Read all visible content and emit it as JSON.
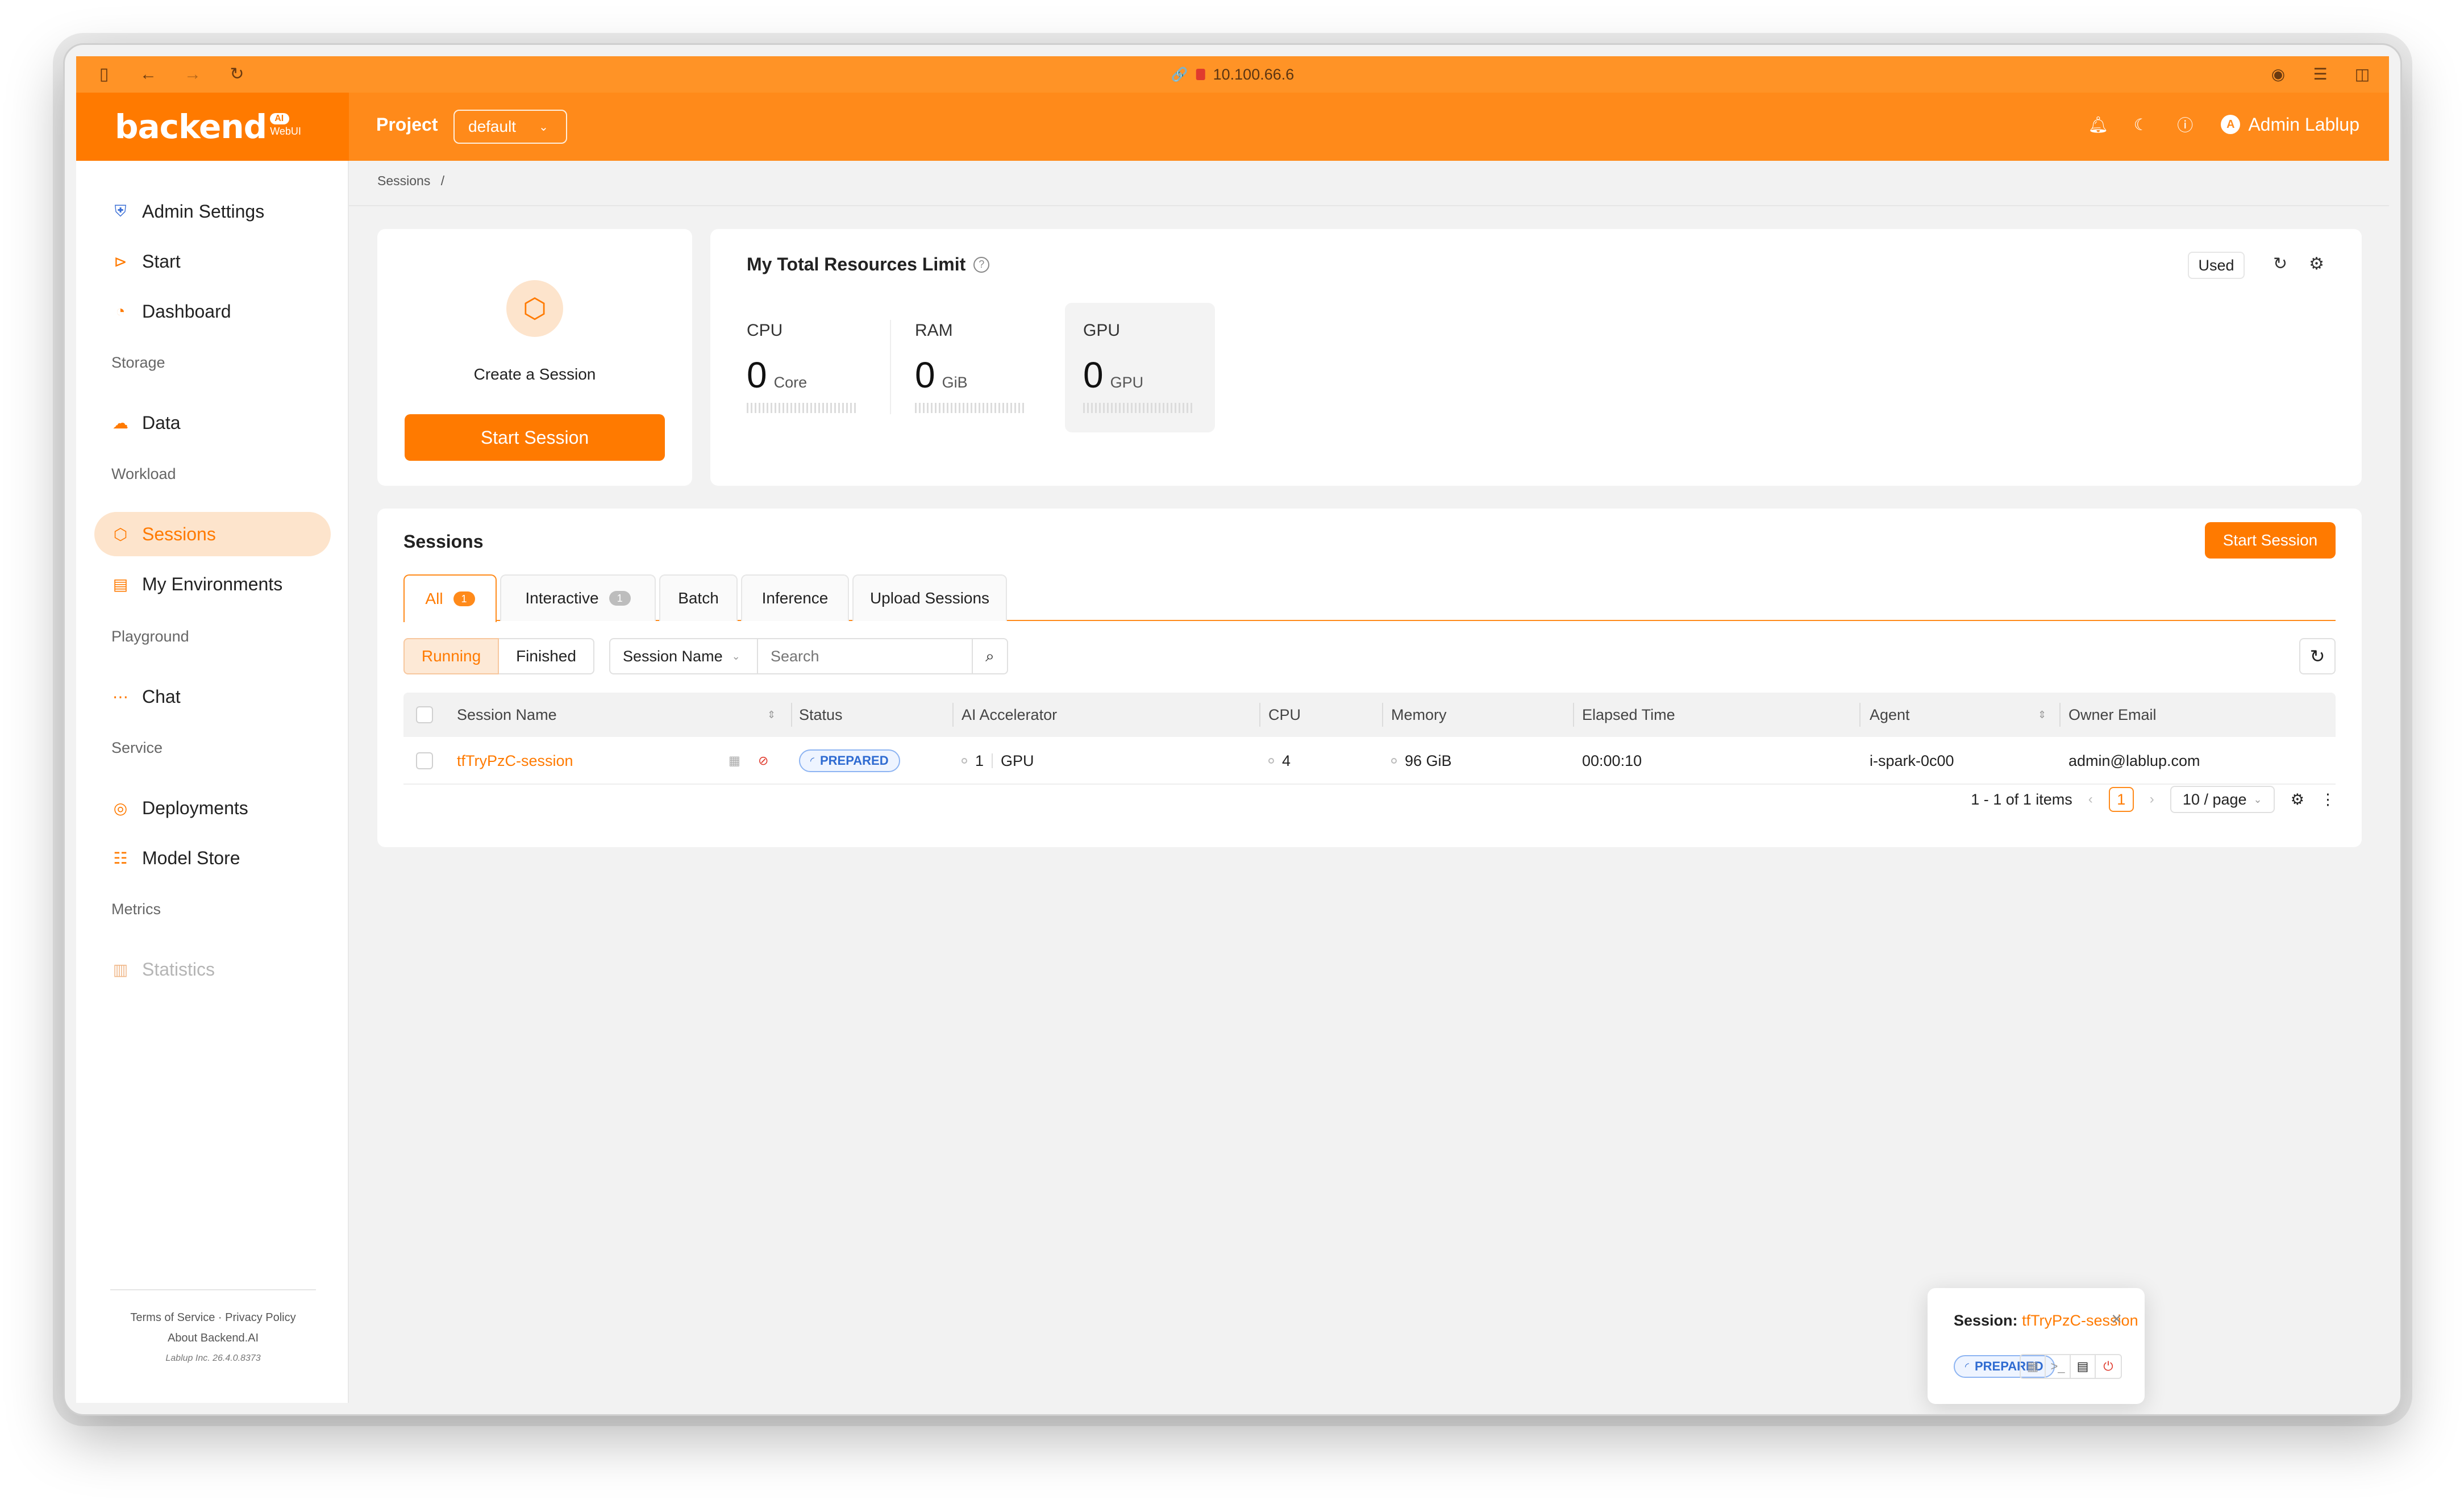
{
  "browser": {
    "url": "10.100.66.6"
  },
  "header": {
    "logo": "backend",
    "logo_badge": "AI",
    "logo_sub": "WebUI",
    "project_label": "Project",
    "project_value": "default",
    "user_name": "Admin Lablup",
    "user_initial": "A"
  },
  "sidebar": {
    "items": [
      {
        "label": "Admin Settings",
        "icon": "shield-icon"
      },
      {
        "label": "Start",
        "icon": "play-circle-icon"
      },
      {
        "label": "Dashboard",
        "icon": "dashboard-icon"
      }
    ],
    "groups": {
      "storage": "Storage",
      "workload": "Workload",
      "playground": "Playground",
      "service": "Service",
      "metrics": "Metrics"
    },
    "storage_items": [
      {
        "label": "Data",
        "icon": "cloud-upload-icon"
      }
    ],
    "workload_items": [
      {
        "label": "Sessions",
        "icon": "cube-icon",
        "active": true
      },
      {
        "label": "My Environments",
        "icon": "file-image-icon"
      }
    ],
    "playground_items": [
      {
        "label": "Chat",
        "icon": "chat-icon"
      }
    ],
    "service_items": [
      {
        "label": "Deployments",
        "icon": "rocket-icon"
      },
      {
        "label": "Model Store",
        "icon": "database-icon"
      }
    ],
    "metrics_items": [
      {
        "label": "Statistics",
        "icon": "bar-chart-icon",
        "disabled": true
      }
    ],
    "footer": {
      "terms": "Terms of Service",
      "privacy": "Privacy Policy",
      "about": "About Backend.AI",
      "version": "Lablup Inc. 26.4.0.8373"
    }
  },
  "breadcrumb": {
    "item": "Sessions",
    "sep": "/"
  },
  "create_card": {
    "title": "Create a Session",
    "button": "Start Session"
  },
  "resources": {
    "title": "My Total Resources Limit",
    "toggle": "Used",
    "items": [
      {
        "label": "CPU",
        "value": "0",
        "unit": "Core"
      },
      {
        "label": "RAM",
        "value": "0",
        "unit": "GiB"
      },
      {
        "label": "GPU",
        "value": "0",
        "unit": "GPU"
      }
    ]
  },
  "sessions": {
    "title": "Sessions",
    "start_button": "Start Session",
    "tabs": [
      {
        "label": "All",
        "badge": "1"
      },
      {
        "label": "Interactive",
        "badge": "1"
      },
      {
        "label": "Batch"
      },
      {
        "label": "Inference"
      },
      {
        "label": "Upload Sessions"
      }
    ],
    "filters": {
      "running": "Running",
      "finished": "Finished"
    },
    "search_field": "Session Name",
    "search_placeholder": "Search",
    "columns": [
      "Session Name",
      "Status",
      "AI Accelerator",
      "CPU",
      "Memory",
      "Elapsed Time",
      "Agent",
      "Owner Email"
    ],
    "rows": [
      {
        "name": "tfTryPzC-session",
        "status": "PREPARED",
        "accel_count": "1",
        "accel_type": "GPU",
        "cpu": "4",
        "memory": "96 GiB",
        "elapsed": "00:00:10",
        "agent": "i-spark-0c00",
        "owner": "admin@lablup.com"
      }
    ],
    "pagination": {
      "summary": "1 - 1 of 1 items",
      "page": "1",
      "page_size": "10 / page"
    }
  },
  "toast": {
    "label": "Session:",
    "name": "tfTryPzC-session",
    "status": "PREPARED"
  },
  "colors": {
    "brand": "#ff7a00",
    "header": "#ff8a1a",
    "status_blue": "#2f6bd1"
  }
}
